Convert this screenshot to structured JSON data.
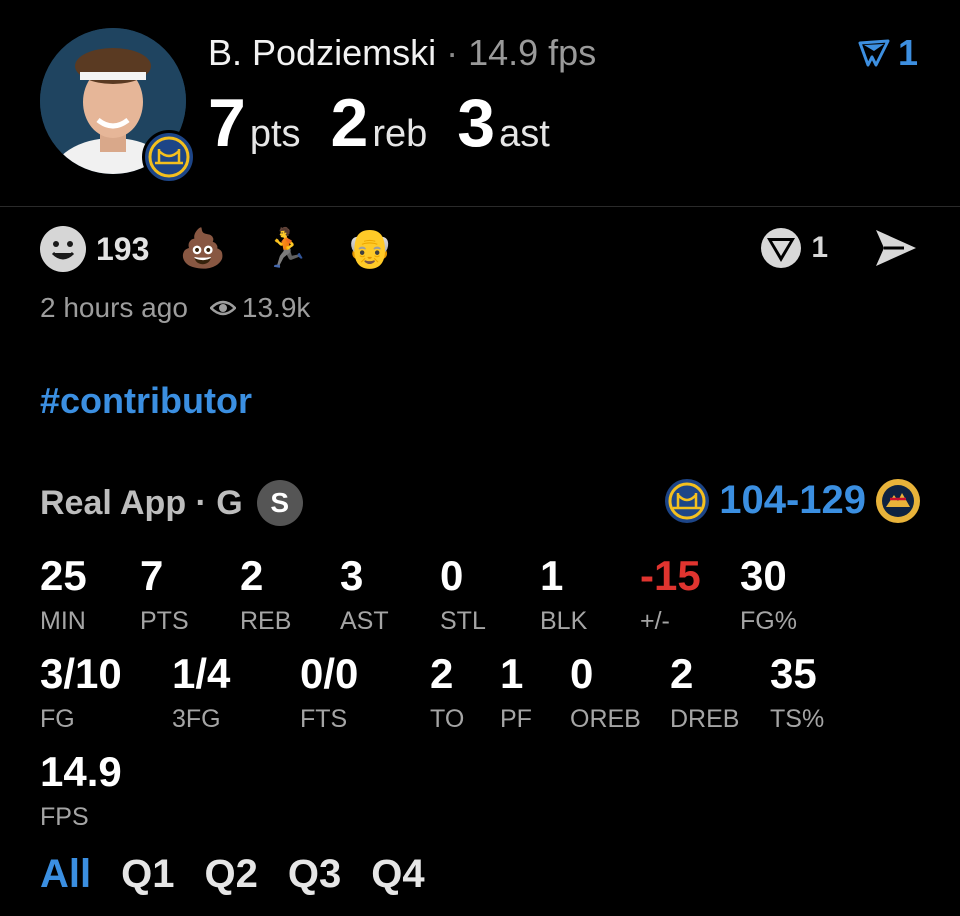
{
  "player": {
    "name": "B. Podziemski",
    "separator": "·",
    "fps_text": "14.9 fps"
  },
  "headline": {
    "pts": "7",
    "pts_unit": "pts",
    "reb": "2",
    "reb_unit": "reb",
    "ast": "3",
    "ast_unit": "ast"
  },
  "top_vote_count": "1",
  "reactions": {
    "smiley_count": "193",
    "emojis": [
      "💩",
      "🏃",
      "👴"
    ]
  },
  "post_vote_count": "1",
  "meta": {
    "time_ago": "2 hours ago",
    "views": "13.9k"
  },
  "hashtag": "#contributor",
  "game": {
    "label": "Real App · G",
    "badge": "S",
    "score": "104-129"
  },
  "stats": [
    {
      "value": "25",
      "label": "MIN"
    },
    {
      "value": "7",
      "label": "PTS"
    },
    {
      "value": "2",
      "label": "REB"
    },
    {
      "value": "3",
      "label": "AST"
    },
    {
      "value": "0",
      "label": "STL"
    },
    {
      "value": "1",
      "label": "BLK"
    },
    {
      "value": "-15",
      "label": "+/-"
    },
    {
      "value": "30",
      "label": "FG%"
    },
    {
      "value": "3/10",
      "label": "FG"
    },
    {
      "value": "1/4",
      "label": "3FG"
    },
    {
      "value": "0/0",
      "label": "FTS"
    },
    {
      "value": "2",
      "label": "TO"
    },
    {
      "value": "1",
      "label": "PF"
    },
    {
      "value": "0",
      "label": "OREB"
    },
    {
      "value": "2",
      "label": "DREB"
    },
    {
      "value": "35",
      "label": "TS%"
    },
    {
      "value": "14.9",
      "label": "FPS"
    }
  ],
  "tabs": [
    "All",
    "Q1",
    "Q2",
    "Q3",
    "Q4"
  ],
  "colors": {
    "accent": "#3b8fe1",
    "negative": "#e0342f",
    "background": "#000000"
  }
}
